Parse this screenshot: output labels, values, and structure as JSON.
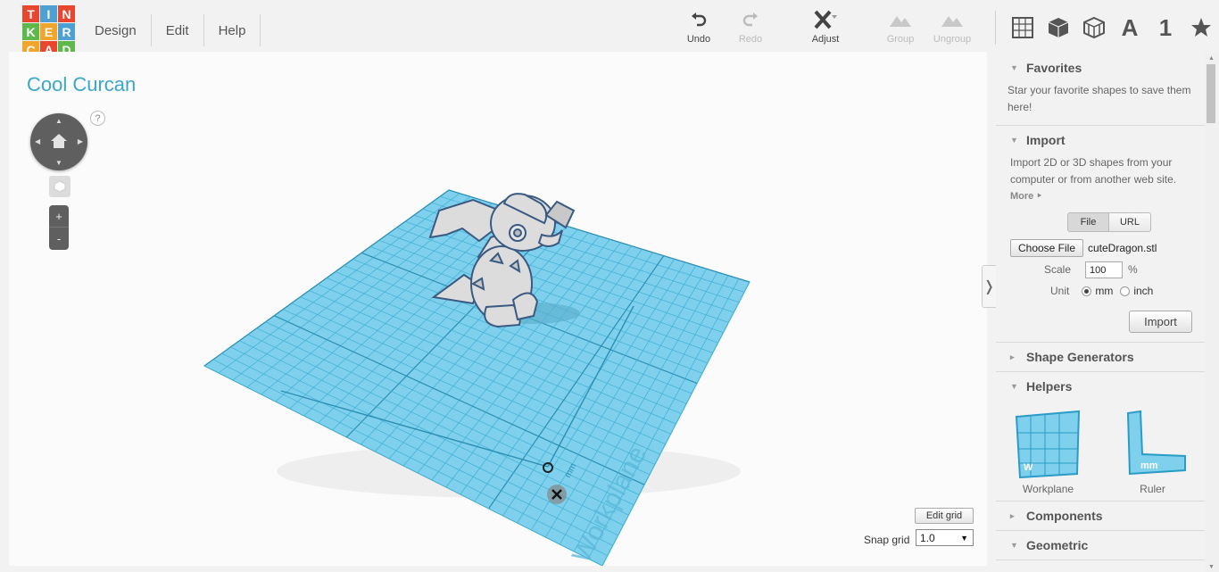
{
  "logo": {
    "letters": [
      "T",
      "I",
      "N",
      "K",
      "E",
      "R",
      "C",
      "A",
      "D"
    ],
    "colors": [
      "#e8462d",
      "#4e9fd2",
      "#e8462d",
      "#5fb84a",
      "#f2a52b",
      "#4e9fd2",
      "#f2a52b",
      "#e8462d",
      "#5fb84a"
    ]
  },
  "menu": {
    "design": "Design",
    "edit": "Edit",
    "help": "Help"
  },
  "toolbar": {
    "undo": "Undo",
    "redo": "Redo",
    "adjust": "Adjust",
    "group": "Group",
    "ungroup": "Ungroup"
  },
  "view_icons": {
    "text_letter": "A",
    "number": "1"
  },
  "canvas": {
    "design_title": "Cool Curcan",
    "help_mark": "?",
    "zoom_in": "+",
    "zoom_out": "-",
    "workplane_label": "Workplane",
    "ruler_unit": "mm",
    "edit_grid": "Edit grid",
    "snap_grid_label": "Snap grid",
    "snap_grid_value": "1.0",
    "accent": "#3aa6c9"
  },
  "sidebar": {
    "favorites": {
      "title": "Favorites",
      "text": "Star your favorite shapes to save them here!"
    },
    "import": {
      "title": "Import",
      "text": "Import 2D or 3D shapes from your computer or from another web site.",
      "more": "More ‣",
      "tab_file": "File",
      "tab_url": "URL",
      "choose_file": "Choose File",
      "file_name": "cuteDragon.stl",
      "scale_label": "Scale",
      "scale_value": "100",
      "scale_unit": "%",
      "unit_label": "Unit",
      "unit_mm": "mm",
      "unit_inch": "inch",
      "selected_unit": "mm",
      "import_button": "Import"
    },
    "shape_generators": {
      "title": "Shape Generators"
    },
    "helpers": {
      "title": "Helpers",
      "workplane": "Workplane",
      "ruler": "Ruler",
      "workplane_mark": "W",
      "ruler_mark": "mm"
    },
    "components": {
      "title": "Components"
    },
    "geometric": {
      "title": "Geometric"
    }
  }
}
